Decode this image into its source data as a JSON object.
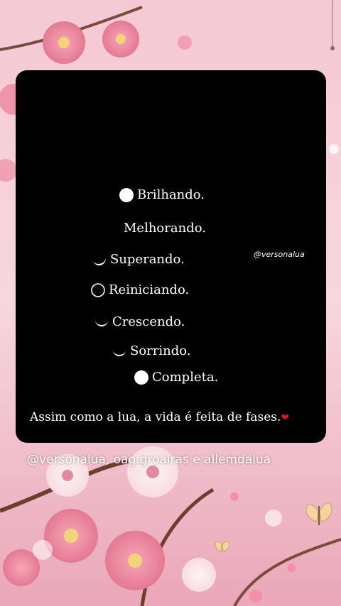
{
  "phases": [
    {
      "label": "Brilhando.",
      "moon": "full-moon-icon"
    },
    {
      "label": "Melhorando.",
      "moon": "crescent-moon-icon"
    },
    {
      "label": "Superando.",
      "moon": "crescent-moon-icon"
    },
    {
      "label": "Reiniciando.",
      "moon": "new-moon-icon"
    },
    {
      "label": "Crescendo.",
      "moon": "crescent-moon-icon"
    },
    {
      "label": "Sorrindo.",
      "moon": "crescent-moon-icon"
    },
    {
      "label": "Completa.",
      "moon": "full-moon-icon"
    }
  ],
  "watermark": "@versonalua",
  "caption": "Assim como a lua, a vida é feita de fases.",
  "caption_emoji": "heart-icon",
  "credit": "@versonalua, oag.groairas e allemdalua",
  "colors": {
    "card": "#000000",
    "text": "#ffffff",
    "heart": "#e0102a",
    "background": "#f2c6d2"
  }
}
